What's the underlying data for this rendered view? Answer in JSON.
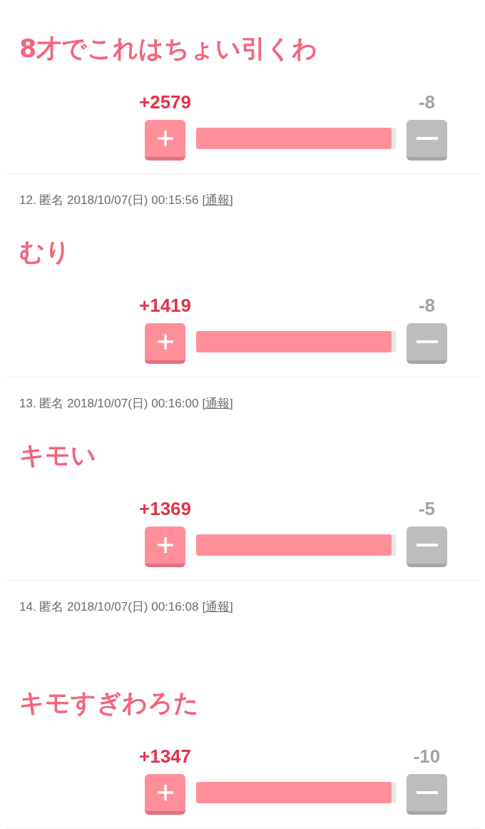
{
  "posts": [
    {
      "body": "8才でこれはちょい引くわ",
      "votes": {
        "plus_count": "+2579",
        "minus_count": "-8",
        "level": 0.98
      }
    },
    {
      "meta": "12. 匿名 2018/10/07(日) 00:15:56",
      "report_link": "[通報]",
      "body": "むり",
      "votes": {
        "plus_count": "+1419",
        "minus_count": "-8",
        "level": 0.98
      }
    },
    {
      "meta": "13. 匿名 2018/10/07(日) 00:16:00",
      "report_link": "[通報]",
      "body": "キモい",
      "votes": {
        "plus_count": "+1369",
        "minus_count": "-5",
        "level": 0.98
      }
    },
    {
      "meta": "14. 匿名 2018/10/07(日) 00:16:08",
      "report_link": "[通報]",
      "body": "キモすぎわろた",
      "votes": {
        "plus_count": "+1347",
        "minus_count": "-10",
        "level": 0.98
      }
    }
  ]
}
